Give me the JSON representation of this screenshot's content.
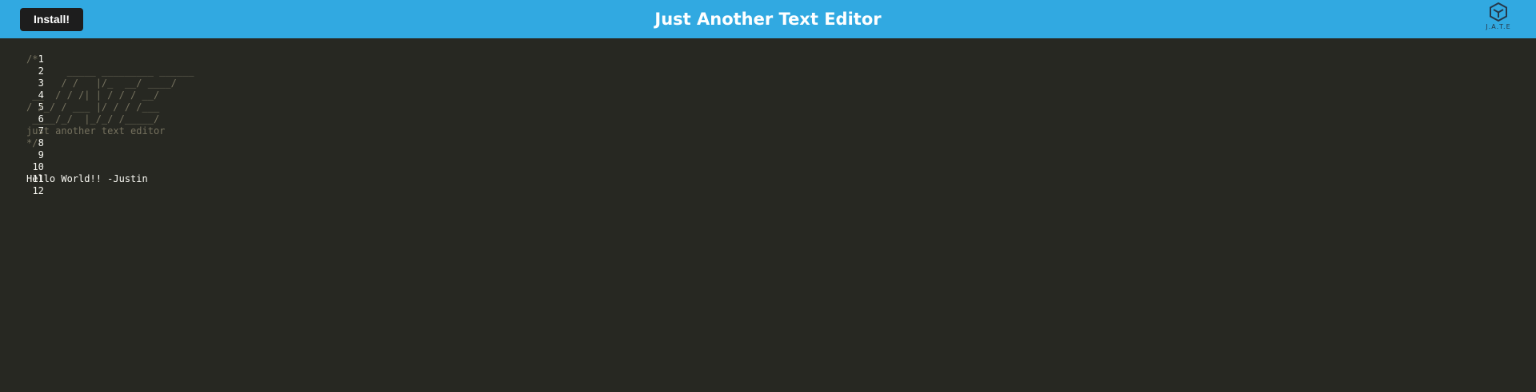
{
  "header": {
    "install_label": "Install!",
    "title": "Just Another Text Editor",
    "logo_text": "J.A.T.E",
    "logo_icon": "cube-logo-icon"
  },
  "colors": {
    "header_bg": "#31a9e1",
    "button_bg": "#1d1d1d",
    "editor_bg": "#272822",
    "comment": "#75715e",
    "text": "#f8f8f2"
  },
  "editor": {
    "lines": [
      {
        "number": "1",
        "text": "",
        "style": "plain"
      },
      {
        "number": "2",
        "text": "/*",
        "style": "comment"
      },
      {
        "number": "3",
        "text": "       _____ _________ ______",
        "style": "comment"
      },
      {
        "number": "4",
        "text": "      / /   |/_  __/ ____/",
        "style": "comment"
      },
      {
        "number": "5",
        "text": " __  / / /| | / / / __/",
        "style": "comment"
      },
      {
        "number": "6",
        "text": "/ /_/ / ___ |/ / / /___",
        "style": "comment"
      },
      {
        "number": "7",
        "text": " ____/_/  |_/_/ /_____/",
        "style": "comment"
      },
      {
        "number": "8",
        "text": "just another text editor",
        "style": "comment"
      },
      {
        "number": "9",
        "text": "*/",
        "style": "comment"
      },
      {
        "number": "10",
        "text": "",
        "style": "plain"
      },
      {
        "number": "11",
        "text": "",
        "style": "plain"
      },
      {
        "number": "12",
        "text": "Hello World!! -Justin",
        "style": "plain"
      }
    ]
  }
}
